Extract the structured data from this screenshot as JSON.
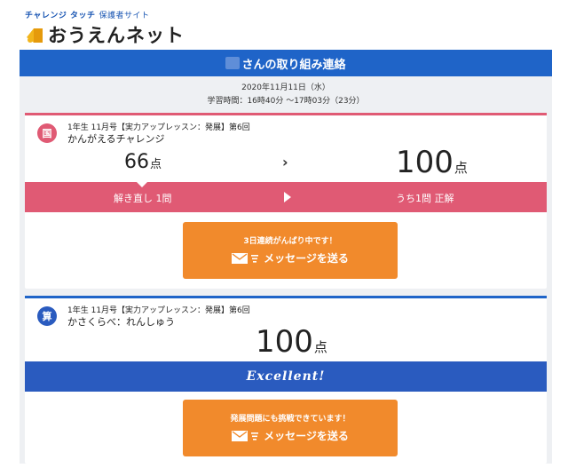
{
  "header": {
    "brand_top": "チャレンジ タッチ",
    "brand_top_sub": "保護者サイト",
    "brand_main": "おうえんネット"
  },
  "report": {
    "title": "さんの取り組み連絡",
    "date": "2020年11月11日（水）",
    "study_time": "学習時間：16時40分 〜17時03分（23分）"
  },
  "cards": [
    {
      "subject": "国",
      "lesson_info": "1年生 11月号【実力アップレッスン：発展】第6回",
      "lesson_title": "かんがえるチャレンジ",
      "score_first": "66",
      "score_second": "100",
      "unit": "点",
      "arrow": "›",
      "retry_label": "解き直し 1問",
      "correct_label": "うち1問 正解",
      "caption": "3日連続がんばり中です！",
      "send_label": "メッセージを送る"
    },
    {
      "subject": "算",
      "lesson_info": "1年生 11月号【実力アップレッスン：発展】第6回",
      "lesson_title": "かさくらべ：れんしゅう",
      "score": "100",
      "unit": "点",
      "excellent": "Excellent!",
      "caption": "発展問題にも挑戦できています！",
      "send_label": "メッセージを送る"
    }
  ],
  "colors": {
    "primary_blue": "#1f64c8",
    "japanese_pink": "#e05a74",
    "math_blue": "#2a5bbf",
    "button_orange": "#f18a2c",
    "panel_bg": "#eef0f3"
  },
  "icons": {
    "logo": "megaphone-icon",
    "mail": "mail-icon",
    "next": "play-icon"
  }
}
